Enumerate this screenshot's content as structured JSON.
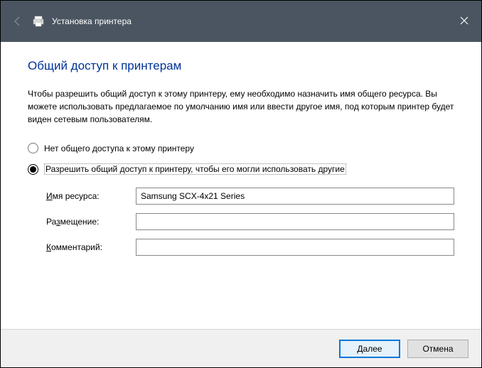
{
  "titlebar": {
    "title": "Установка принтера"
  },
  "heading": "Общий доступ к принтерам",
  "description": "Чтобы разрешить общий доступ к этому принтеру, ему необходимо назначить имя общего ресурса. Вы можете использовать предлагаемое по умолчанию имя или ввести другое имя, под которым принтер будет виден сетевым пользователям.",
  "radio": {
    "no_share": "Нет общего доступа к этому принтеру",
    "share": "Разрешить общий доступ к принтеру, чтобы его могли использовать другие"
  },
  "form": {
    "share_name_label_pre": "И",
    "share_name_label_rest": "мя ресурса:",
    "share_name_value": "Samsung SCX-4x21 Series",
    "location_label_pre": "Ра",
    "location_label_u": "з",
    "location_label_rest": "мещение:",
    "location_value": "",
    "comment_label_u": "К",
    "comment_label_rest": "омментарий:",
    "comment_value": ""
  },
  "buttons": {
    "next_u": "Д",
    "next_rest": "алее",
    "cancel": "Отмена"
  }
}
